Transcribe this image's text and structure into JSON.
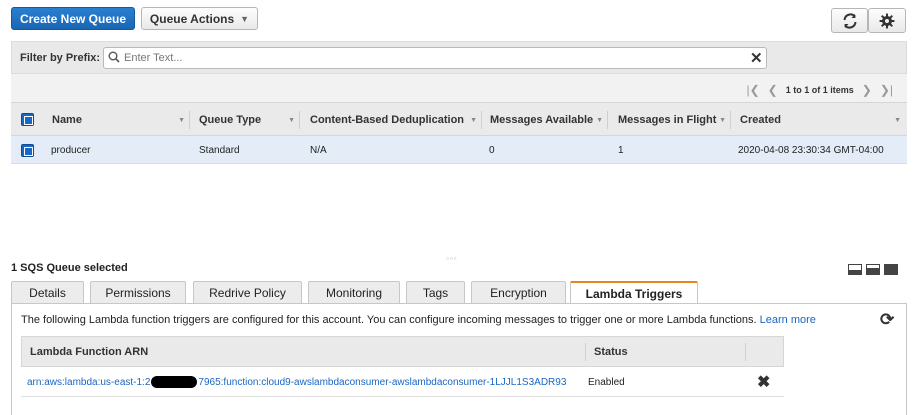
{
  "toolbar": {
    "create_label": "Create New Queue",
    "actions_label": "Queue Actions",
    "actions_caret": "▼"
  },
  "filter": {
    "label": "Filter by Prefix:",
    "placeholder": "Enter Text...",
    "value": ""
  },
  "pager": {
    "text": "1 to 1 of 1 items"
  },
  "table": {
    "columns": [
      "Name",
      "Queue Type",
      "Content-Based Deduplication",
      "Messages Available",
      "Messages in Flight",
      "Created"
    ],
    "rows": [
      {
        "name": "producer",
        "queue_type": "Standard",
        "dedup": "N/A",
        "available": "0",
        "in_flight": "1",
        "created": "2020-04-08 23:30:34 GMT-04:00"
      }
    ]
  },
  "selection": {
    "count_text": "1 SQS Queue selected"
  },
  "tabs": [
    "Details",
    "Permissions",
    "Redrive Policy",
    "Monitoring",
    "Tags",
    "Encryption",
    "Lambda Triggers"
  ],
  "active_tab": "Lambda Triggers",
  "lambda": {
    "info_text": "The following Lambda function triggers are configured for this account. You can configure incoming messages to trigger one or more Lambda functions.",
    "learn_more": "Learn more",
    "columns": [
      "Lambda Function ARN",
      "Status"
    ],
    "arn_prefix": "arn:aws:lambda:us-east-1:2",
    "arn_suffix": "7965:function:cloud9-awslambdaconsumer-awslambdaconsumer-1LJJL1S3ADR93",
    "status": "Enabled"
  },
  "icons": {
    "refresh": "refresh-icon",
    "settings": "gear-icon",
    "search": "search-icon",
    "clear": "close-icon",
    "delete": "close-icon"
  },
  "colors": {
    "primary": "#1a66c4",
    "selected_row": "#e3ecf7",
    "active_tab_accent": "#e8871e"
  }
}
